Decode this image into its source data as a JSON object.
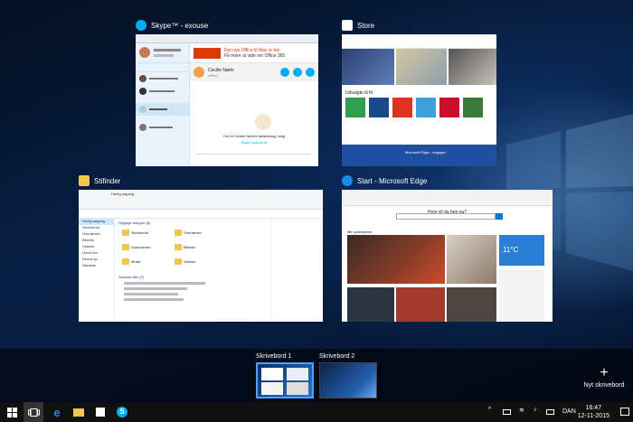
{
  "windows": {
    "skype": {
      "title": "Skype™ - exouse",
      "office_banner": "Det nye Office til Mac er her",
      "office_banner_sub": "Få mere at vide om Office 365",
      "contact_name": "Cecilie Næhr",
      "contact_status": "offline",
      "birthday_title": "Det er Cecilie Næhrs fødselsdag i dag",
      "birthday_sub": "Skype gratulerer"
    },
    "store": {
      "title": "Store",
      "section_apps": "Udvalgte til fri",
      "section_bottom": "Microsoft Edge - engagér"
    },
    "file_explorer": {
      "title": "Stifinder",
      "breadcrumb": "Hurtig adgang",
      "frequent_folders_heading": "Hyppige mapper (6)",
      "recent_files_heading": "Seneste filer (7)",
      "folders": [
        "Skrivebord",
        "Overførsler",
        "Dokumenter",
        "Billeder",
        "Musik",
        "Videoer"
      ],
      "nav_items": [
        "Hurtig adgang",
        "Skrivebord",
        "Overførsler",
        "Billeder",
        "Videoer",
        "OneDrive",
        "Denne pc",
        "Netværk"
      ]
    },
    "edge": {
      "title": "Start - Microsoft Edge",
      "search_prompt": "Hvor vil du hen nu?",
      "news_heading": "Mit nyhedsfeed",
      "weather_temp": "11°C"
    }
  },
  "desktops": {
    "desktop1_label": "Skrivebord 1",
    "desktop2_label": "Skrivebord 2",
    "new_desktop_label": "Nyt skrivebord",
    "new_desktop_icon": "plus-icon"
  },
  "taskbar": {
    "language": "DAN",
    "time": "16:47",
    "date": "12-11-2015",
    "icons": [
      "windows-start-icon",
      "task-view-icon",
      "edge-icon",
      "file-explorer-icon",
      "store-icon",
      "skype-icon"
    ]
  },
  "colors": {
    "skype_blue": "#00aff0",
    "office_orange": "#d83b01",
    "edge_blue": "#0078d7",
    "selection_blue": "#4aa3ff"
  }
}
